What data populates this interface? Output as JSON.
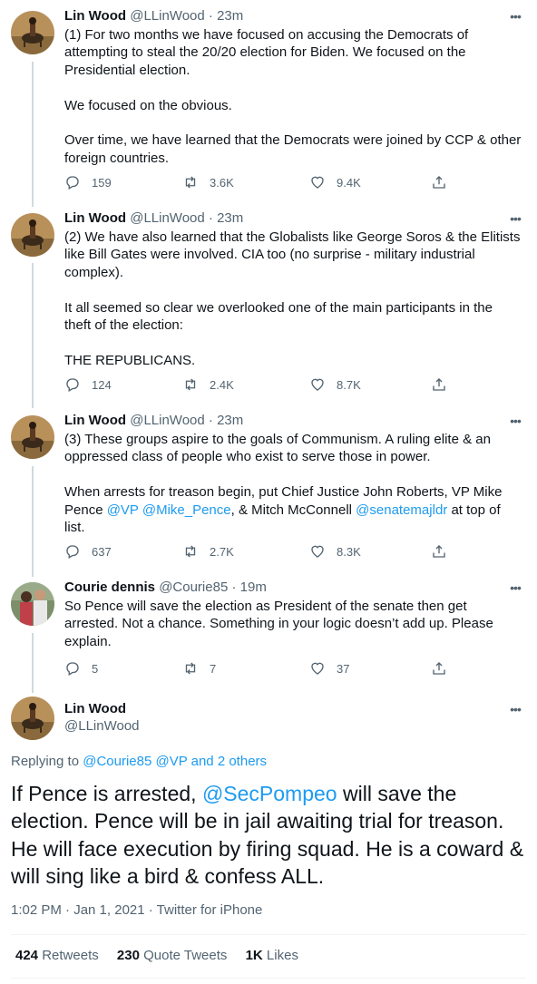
{
  "tweets": [
    {
      "name": "Lin Wood",
      "handle": "@LLinWood",
      "time": "23m",
      "paragraphs": [
        "(1) For two months we have focused on accusing the Democrats of attempting to steal the 20/20 election for Biden. We focused on the Presidential election.",
        "We focused on the obvious.",
        "Over time, we have learned that the Democrats were joined by CCP & other foreign countries."
      ],
      "replies": "159",
      "retweets": "3.6K",
      "likes": "9.4K"
    },
    {
      "name": "Lin Wood",
      "handle": "@LLinWood",
      "time": "23m",
      "paragraphs": [
        "(2) We have also learned that the Globalists like George Soros & the Elitists like Bill Gates were involved. CIA too (no surprise - military industrial complex).",
        "It all seemed so clear we overlooked one of the main participants in the theft of the election:",
        "THE REPUBLICANS."
      ],
      "replies": "124",
      "retweets": "2.4K",
      "likes": "8.7K"
    },
    {
      "name": "Lin Wood",
      "handle": "@LLinWood",
      "time": "23m",
      "p1": "(3) These groups aspire to the goals of Communism. A ruling elite & an oppressed class of people who exist to serve those in power.",
      "p2_a": "When arrests for treason begin, put Chief Justice John Roberts, VP Mike Pence ",
      "p2_link1": "@VP",
      "p2_link2": "@Mike_Pence",
      "p2_b": ", & Mitch McConnell ",
      "p2_link3": "@senatemajldr",
      "p2_c": " at top of list.",
      "replies": "637",
      "retweets": "2.7K",
      "likes": "8.3K"
    },
    {
      "name": "Courie dennis",
      "handle": "@Courie85",
      "time": "19m",
      "paragraphs": [
        "So Pence will save the election as President of the senate then get arrested. Not a chance. Something in your logic doesn’t add up. Please explain."
      ],
      "replies": "5",
      "retweets": "7",
      "likes": "37"
    }
  ],
  "main_tweet": {
    "name": "Lin Wood",
    "handle": "@LLinWood",
    "replying_label": "Replying to",
    "replying_to": "@Courie85 @VP",
    "replying_and": "and",
    "replying_others": "2 others",
    "text_a": "If Pence is arrested, ",
    "text_link": "@SecPompeo",
    "text_b": " will save the election. Pence will be in jail awaiting trial for treason. He will face execution by firing squad. He is a coward & will sing like a bird & confess ALL.",
    "meta": "1:02 PM · Jan 1, 2021 · Twitter for iPhone",
    "retweets_count": "424",
    "retweets_label": "Retweets",
    "quote_count": "230",
    "quote_label": "Quote Tweets",
    "likes_count": "1K",
    "likes_label": "Likes"
  },
  "colors": {
    "link": "#1d9bf0",
    "secondary": "#536471",
    "text": "#0f1419",
    "thread_line": "#cfd9de"
  },
  "icons": [
    "reply-icon",
    "retweet-icon",
    "like-icon",
    "share-icon",
    "more-icon"
  ]
}
